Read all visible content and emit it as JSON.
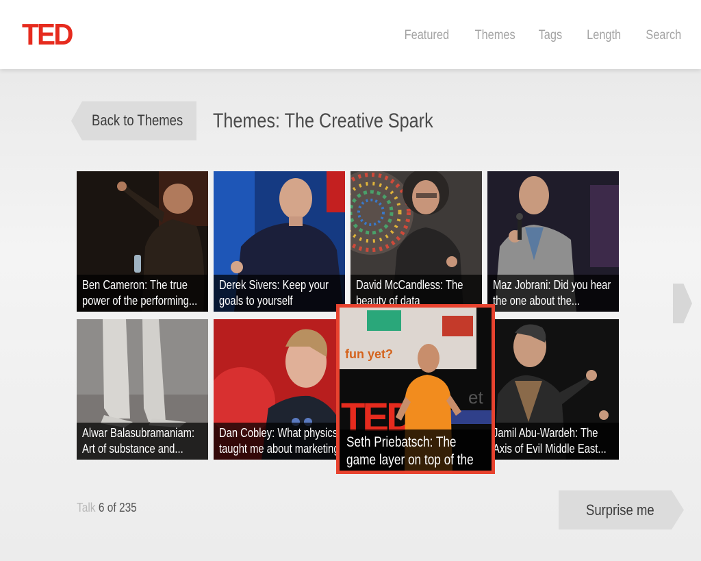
{
  "brand": {
    "logo_text": "TED",
    "accent_color": "#e62b1e"
  },
  "nav": {
    "items": [
      "Featured",
      "Themes",
      "Tags",
      "Length",
      "Search"
    ]
  },
  "header": {
    "back_label": "Back to Themes",
    "title": "Themes: The Creative Spark"
  },
  "talks": [
    {
      "caption": "Ben Cameron: The true power of the performing..."
    },
    {
      "caption": "Derek Sivers: Keep your goals to yourself"
    },
    {
      "caption": "David McCandless: The beauty of data visualization"
    },
    {
      "caption": "Maz Jobrani: Did you hear the one about the..."
    },
    {
      "caption": "Alwar Balasubramaniam: Art of substance and..."
    },
    {
      "caption": "Dan Cobley: What physics taught me about marketing"
    },
    {
      "caption": "Jamil Abu-Wardeh: The Axis of Evil Middle East..."
    }
  ],
  "selected_talk": {
    "caption": "Seth Priebatsch: The game layer on top of the world",
    "slide_text": "fun yet?",
    "stage_text": "TED"
  },
  "footer": {
    "counter_label": "Talk",
    "counter_value": "6 of 235",
    "surprise_label": "Surprise me"
  },
  "icons": {
    "next": "chevron-right-icon",
    "back": "chevron-left-icon"
  }
}
